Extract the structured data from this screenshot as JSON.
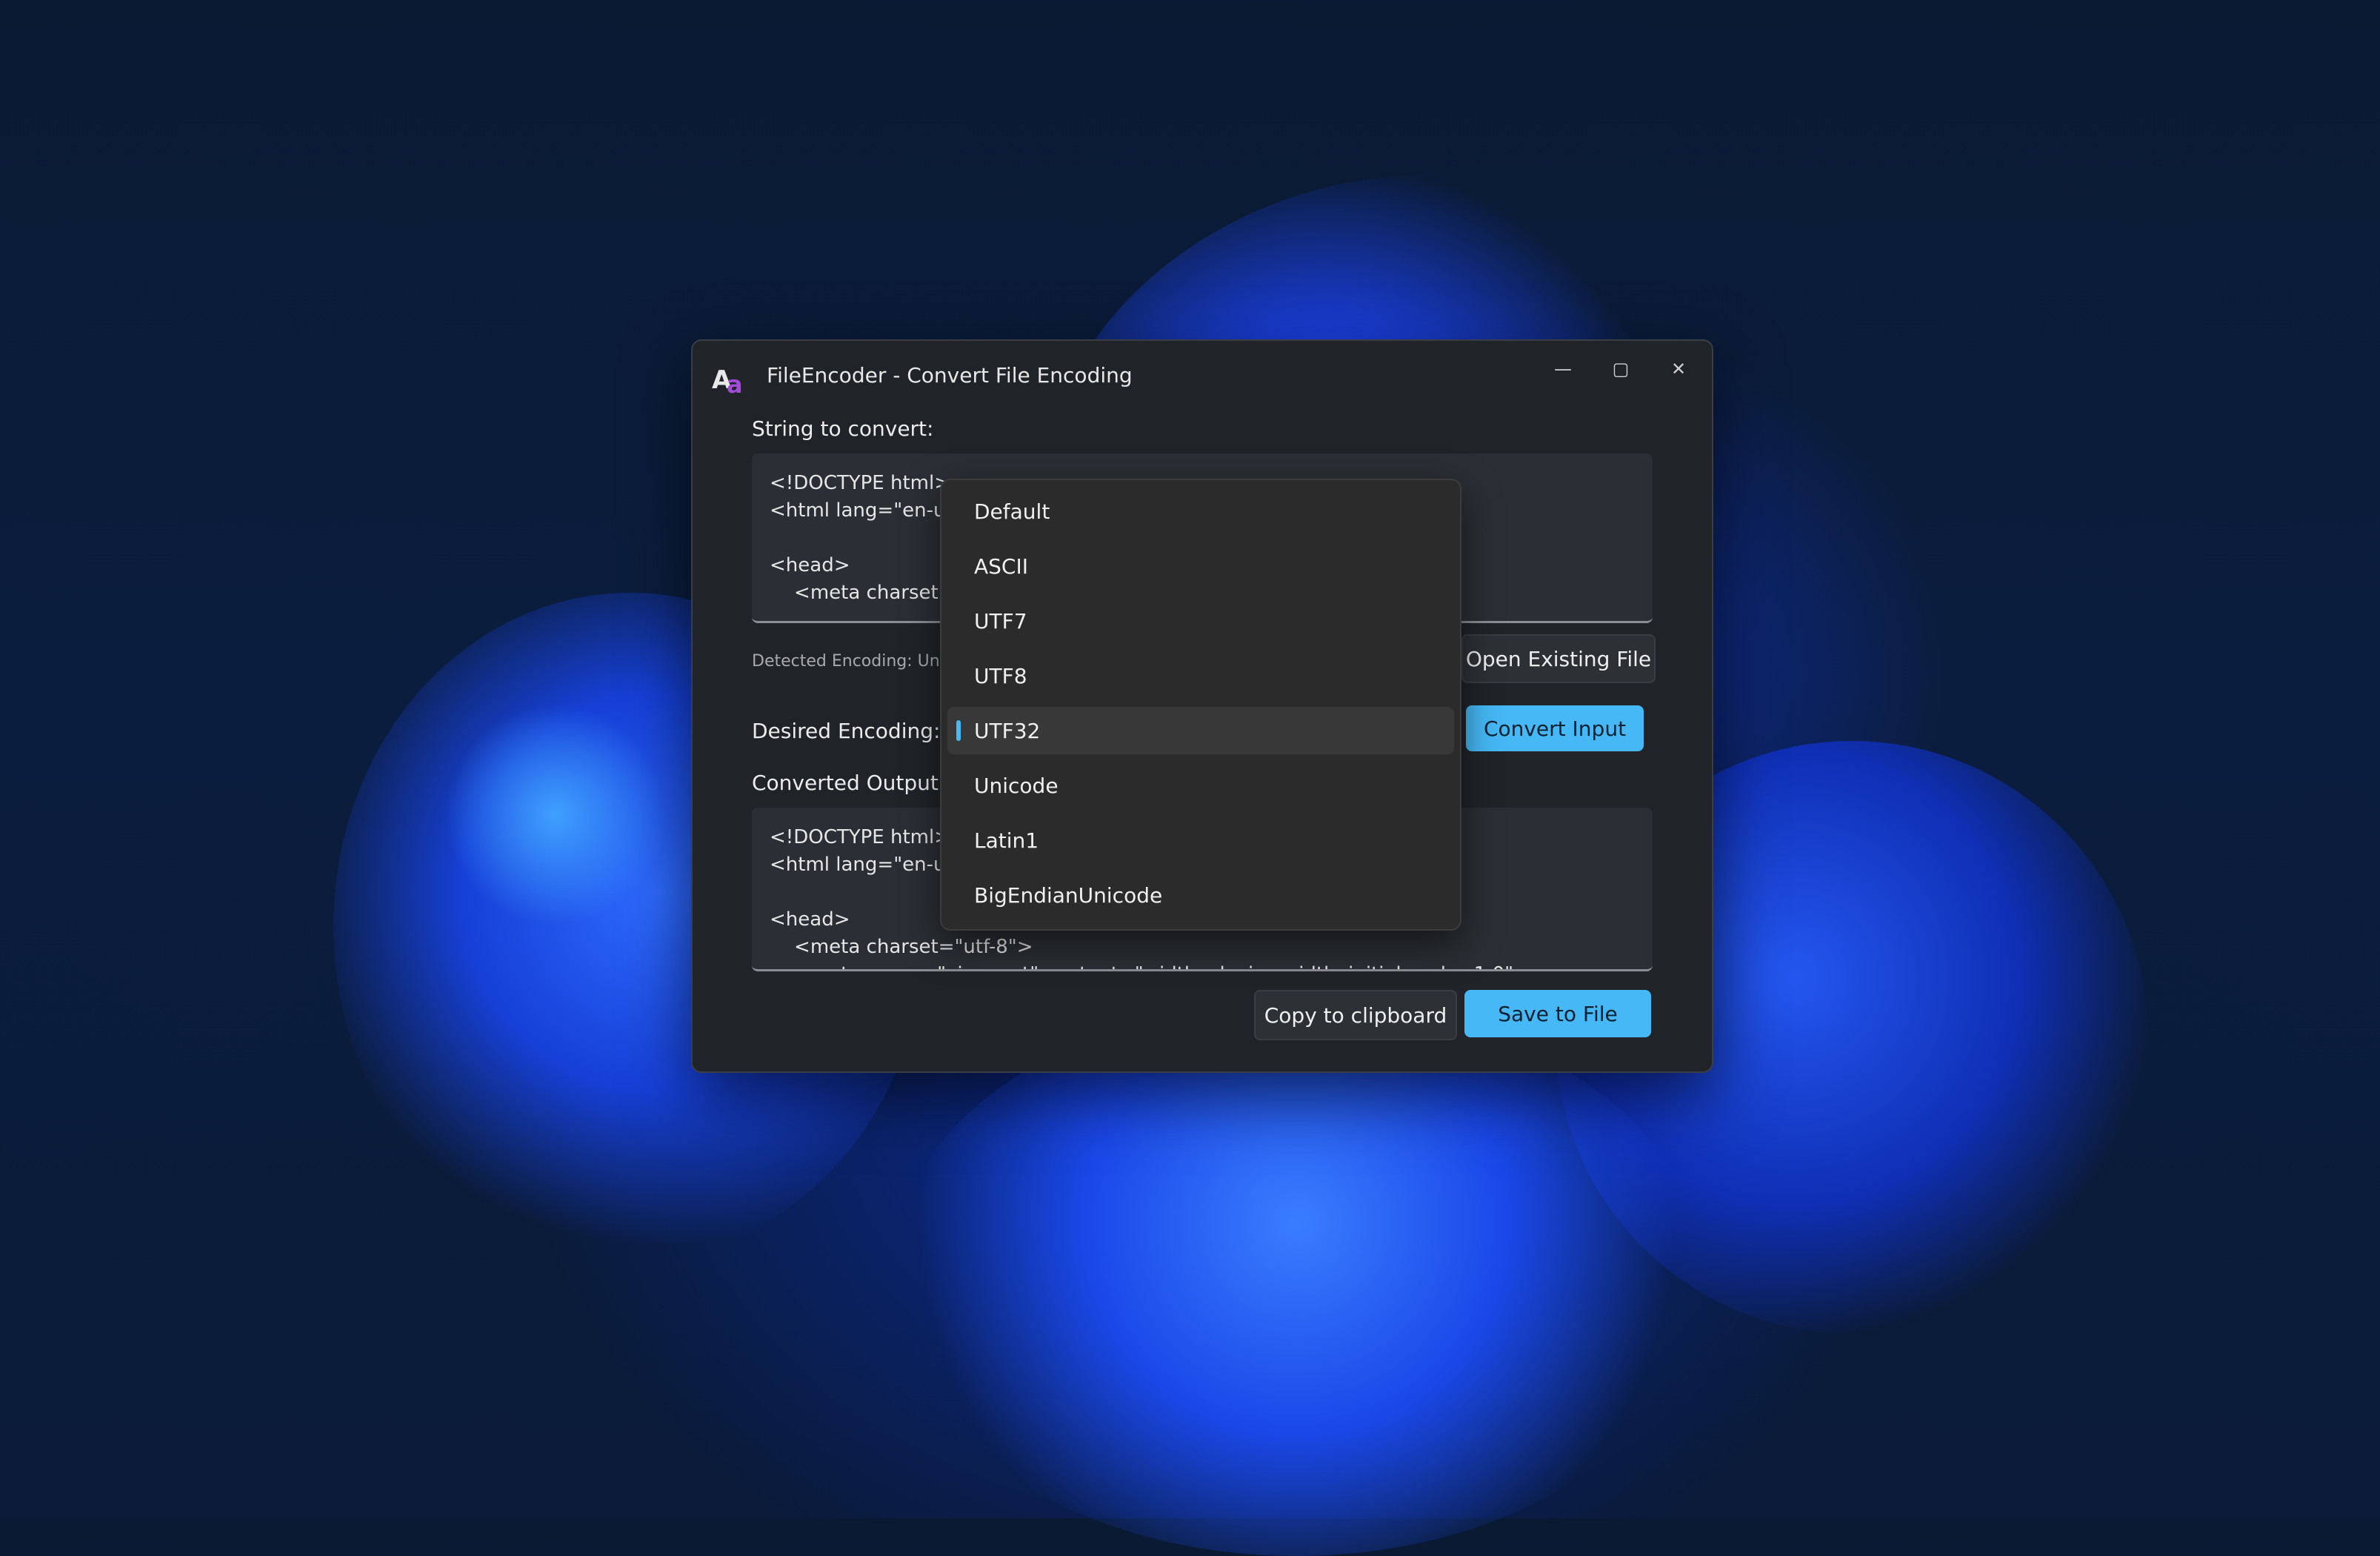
{
  "window": {
    "title": "FileEncoder - Convert File Encoding"
  },
  "caption": {
    "minimize": "—",
    "maximize": "▢",
    "close": "✕"
  },
  "input": {
    "label": "String to convert:",
    "text": "<!DOCTYPE html>\n<html lang=\"en-us\">\n\n<head>\n    <meta charset=\"utf-8\">"
  },
  "detected_encoding": "Detected Encoding: Unicode",
  "buttons": {
    "open_existing": "Open Existing File",
    "convert_input": "Convert Input",
    "copy_clipboard": "Copy to clipboard",
    "save_to_file": "Save to File"
  },
  "desired_encoding": {
    "label": "Desired Encoding:",
    "selected": "UTF32"
  },
  "output": {
    "label": "Converted Output",
    "text": "<!DOCTYPE html>\n<html lang=\"en-us\">\n\n<head>\n    <meta charset=\"utf-8\">\n    <meta name=\"viewport\" content=\"width=device-width, initial-scale=1.0\">"
  },
  "dropdown": {
    "options": [
      "Default",
      "ASCII",
      "UTF7",
      "UTF8",
      "UTF32",
      "Unicode",
      "Latin1",
      "BigEndianUnicode"
    ]
  },
  "colors": {
    "accent": "#45b8f5",
    "window_bg": "#202428"
  }
}
